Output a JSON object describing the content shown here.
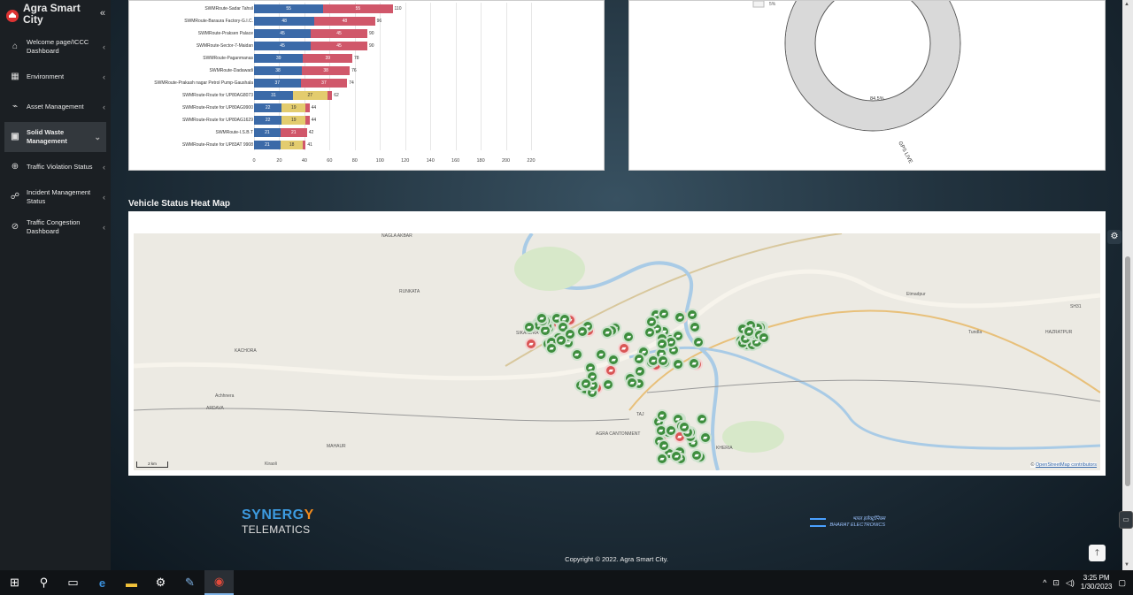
{
  "sidebar": {
    "brand": "Agra Smart City",
    "collapse_icon": "«",
    "items": [
      {
        "label": "Welcome page/ICCC Dashboard",
        "icon": "⌂"
      },
      {
        "label": "Environment",
        "icon": "▦"
      },
      {
        "label": "Asset Management",
        "icon": "⌁"
      },
      {
        "label": "Solid Waste Management",
        "icon": "▣"
      },
      {
        "label": "Traffic Violation Status",
        "icon": "⊕"
      },
      {
        "label": "Incident Management Status",
        "icon": "☍"
      },
      {
        "label": "Traffic Congestion Dashboard",
        "icon": "⊘"
      }
    ]
  },
  "bar_chart": {
    "type": "bar",
    "rows": [
      {
        "label": "SWMRoute-Sadar Tahsil",
        "blue": 55,
        "red": 55,
        "total": 110
      },
      {
        "label": "SWMRoute-Baraura Factory-G.I.C.",
        "blue": 48,
        "red": 48,
        "total": 96
      },
      {
        "label": "SWMRoute-Praksen Palace",
        "blue": 45,
        "red": 45,
        "total": 90
      },
      {
        "label": "SWMRoute-Sector-7-Maidan",
        "blue": 45,
        "red": 45,
        "total": 90
      },
      {
        "label": "SWMRoute-Paganmanas",
        "blue": 39,
        "red": 39,
        "total": 78
      },
      {
        "label": "SWMRoute-Dadawadi",
        "blue": 38,
        "red": 38,
        "total": 76
      },
      {
        "label": "SWMRoute-Prakash nagar Petrol Pump-Gaushala",
        "blue": 37,
        "red": 37,
        "total": 74
      },
      {
        "label": "SWMRoute-Route for UP80AG8073",
        "blue": 31,
        "yellow": 27,
        "red": 4,
        "total": 62
      },
      {
        "label": "SWMRoute-Route for UP80AG9900",
        "blue": 22,
        "yellow": 19,
        "red": 3,
        "total": 44
      },
      {
        "label": "SWMRoute-Route for UP80AG1629",
        "blue": 22,
        "yellow": 19,
        "red": 3,
        "total": 44
      },
      {
        "label": "SWMRoute-I.S.B.T",
        "blue": 21,
        "red": 21,
        "total": 42
      },
      {
        "label": "SWMRoute-Route for UP83AT 9908",
        "blue": 21,
        "yellow": 18,
        "red": 2,
        "total": 41
      }
    ],
    "xticks": [
      "0",
      "20",
      "40",
      "60",
      "80",
      "100",
      "120",
      "140",
      "160",
      "180",
      "200",
      "220"
    ],
    "xlim": [
      0,
      220
    ],
    "colors": {
      "blue": "#3b6aa8",
      "red": "#d0576a",
      "yellow": "#e3cc6e"
    }
  },
  "donut": {
    "slice_label": "84.5%",
    "status_label": "GPS LIVE",
    "top_label": "5%"
  },
  "heatmap": {
    "title": "Vehicle Status Heat Map",
    "attribution_prefix": "© ",
    "attribution_link": "OpenStreetMap contributors",
    "scale": "2 km",
    "places": [
      "NAGLA AKBAR",
      "RUNKATA",
      "KACHORA",
      "Achhnera",
      "ARDAVA",
      "MAHAUR",
      "Kiraoli",
      "AGRA CANTONMENT",
      "KHERIA",
      "Etmadpur",
      "Tundla",
      "HAZRATPUR",
      "SH31",
      "SIKANDRA",
      "TAJ"
    ],
    "markers": {
      "green": 120,
      "red": 20
    }
  },
  "footer": {
    "synergy_top": "SYNERG",
    "synergy_y": "Y",
    "synergy_bottom": "TELEMATICS",
    "bel_text1": "भारत इलेक्ट्रॉनिक्स",
    "bel_text2": "BHARAT ELECTRONICS",
    "copyright": "Copyright © 2022. Agra Smart City."
  },
  "taskbar": {
    "icons": [
      "windows-start",
      "search",
      "task-view",
      "edge",
      "file-explorer",
      "settings",
      "notepad",
      "chrome"
    ],
    "time": "3:25 PM",
    "date": "1/30/2023"
  }
}
